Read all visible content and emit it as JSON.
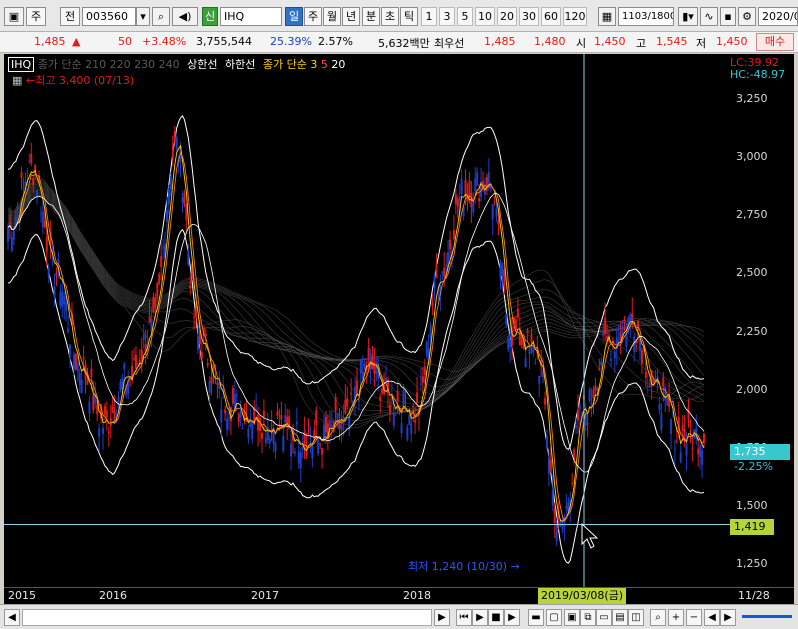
{
  "toolbar": {
    "period_unit": "주",
    "prev_label": "전",
    "stock_code": "003560",
    "new_badge": "신",
    "stock_name": "IHQ",
    "tab_day": "일",
    "tab_week": "주",
    "tab_month": "월",
    "tab_year": "년",
    "tab_minute": "분",
    "tab_second": "초",
    "tab_tick": "틱",
    "periods": [
      "1",
      "3",
      "5",
      "10",
      "20",
      "30",
      "60",
      "120"
    ],
    "count": "1103",
    "count_total": "/1800",
    "date": "2020/0"
  },
  "quote": {
    "price": "1,485",
    "change": "50",
    "change_pct": "+3.48%",
    "volume": "3,755,544",
    "volume_pct": "25.39%",
    "turnover": "2.57%",
    "amount": "5,632백만",
    "ask_label": "최우선",
    "ask": "1,485",
    "bid": "1,480",
    "open_label": "시",
    "open": "1,450",
    "high_label": "고",
    "high": "1,545",
    "low_label": "저",
    "low": "1,450",
    "buy_label": "매수"
  },
  "legend": {
    "name": "IHQ",
    "ma_faded": "종가 단순 210 220 230 240",
    "upper_band": "상한선",
    "lower_band": "하한선",
    "ma_label": "종가 단순",
    "ma3": "3",
    "ma5": "5",
    "ma20": "20",
    "high_note": "←최고 3,400 (07/13)",
    "low_note": "최저 1,240 (10/30) →"
  },
  "lc_label": "LC:39.92",
  "hc_label": "HC:-48.97",
  "current_price": "1,735",
  "current_change": "-2.25%",
  "crosshair_price": "1,419",
  "crosshair_date": "2019/03/08(금)",
  "colors": {
    "up": "#e01b1b",
    "down": "#1a3fc8",
    "band": "#ffffff",
    "ma_faded": "#5a5a5a",
    "crosshair": "#8fd4dc",
    "current_badge": "#37c7cc",
    "crosshair_badge": "#b6d437"
  },
  "chart_data": {
    "type": "line",
    "title": "IHQ",
    "x_ticks": [
      "2015",
      "2016",
      "2017",
      "2018",
      "11/28"
    ],
    "y_ticks": [
      3250,
      3000,
      2750,
      2500,
      2250,
      2000,
      1750,
      1500,
      1250
    ],
    "ylim": [
      1150,
      3350
    ],
    "x": [
      "2015-01",
      "2015-03",
      "2015-05",
      "2015-07",
      "2015-09",
      "2015-11",
      "2016-01",
      "2016-03",
      "2016-05",
      "2016-07",
      "2016-09",
      "2016-11",
      "2017-01",
      "2017-03",
      "2017-05",
      "2017-07",
      "2017-09",
      "2017-11",
      "2018-01",
      "2018-03",
      "2018-05",
      "2018-07",
      "2018-09",
      "2018-11",
      "2019-01",
      "2019-03",
      "2019-05",
      "2019-07",
      "2019-09",
      "2019-11"
    ],
    "series": [
      {
        "values": [
          2700,
          2950,
          2500,
          2100,
          1850,
          2050,
          2250,
          3050,
          2200,
          1950,
          1900,
          1850,
          1800,
          1780,
          1850,
          2100,
          1950,
          1900,
          2500,
          2850,
          2900,
          2250,
          2150,
          1400,
          1900,
          2200,
          2300,
          2000,
          1800,
          1800
        ]
      }
    ],
    "annotations": [
      "←최고 3,400 (07/13)",
      "최저 1,240 (10/30) →"
    ]
  }
}
